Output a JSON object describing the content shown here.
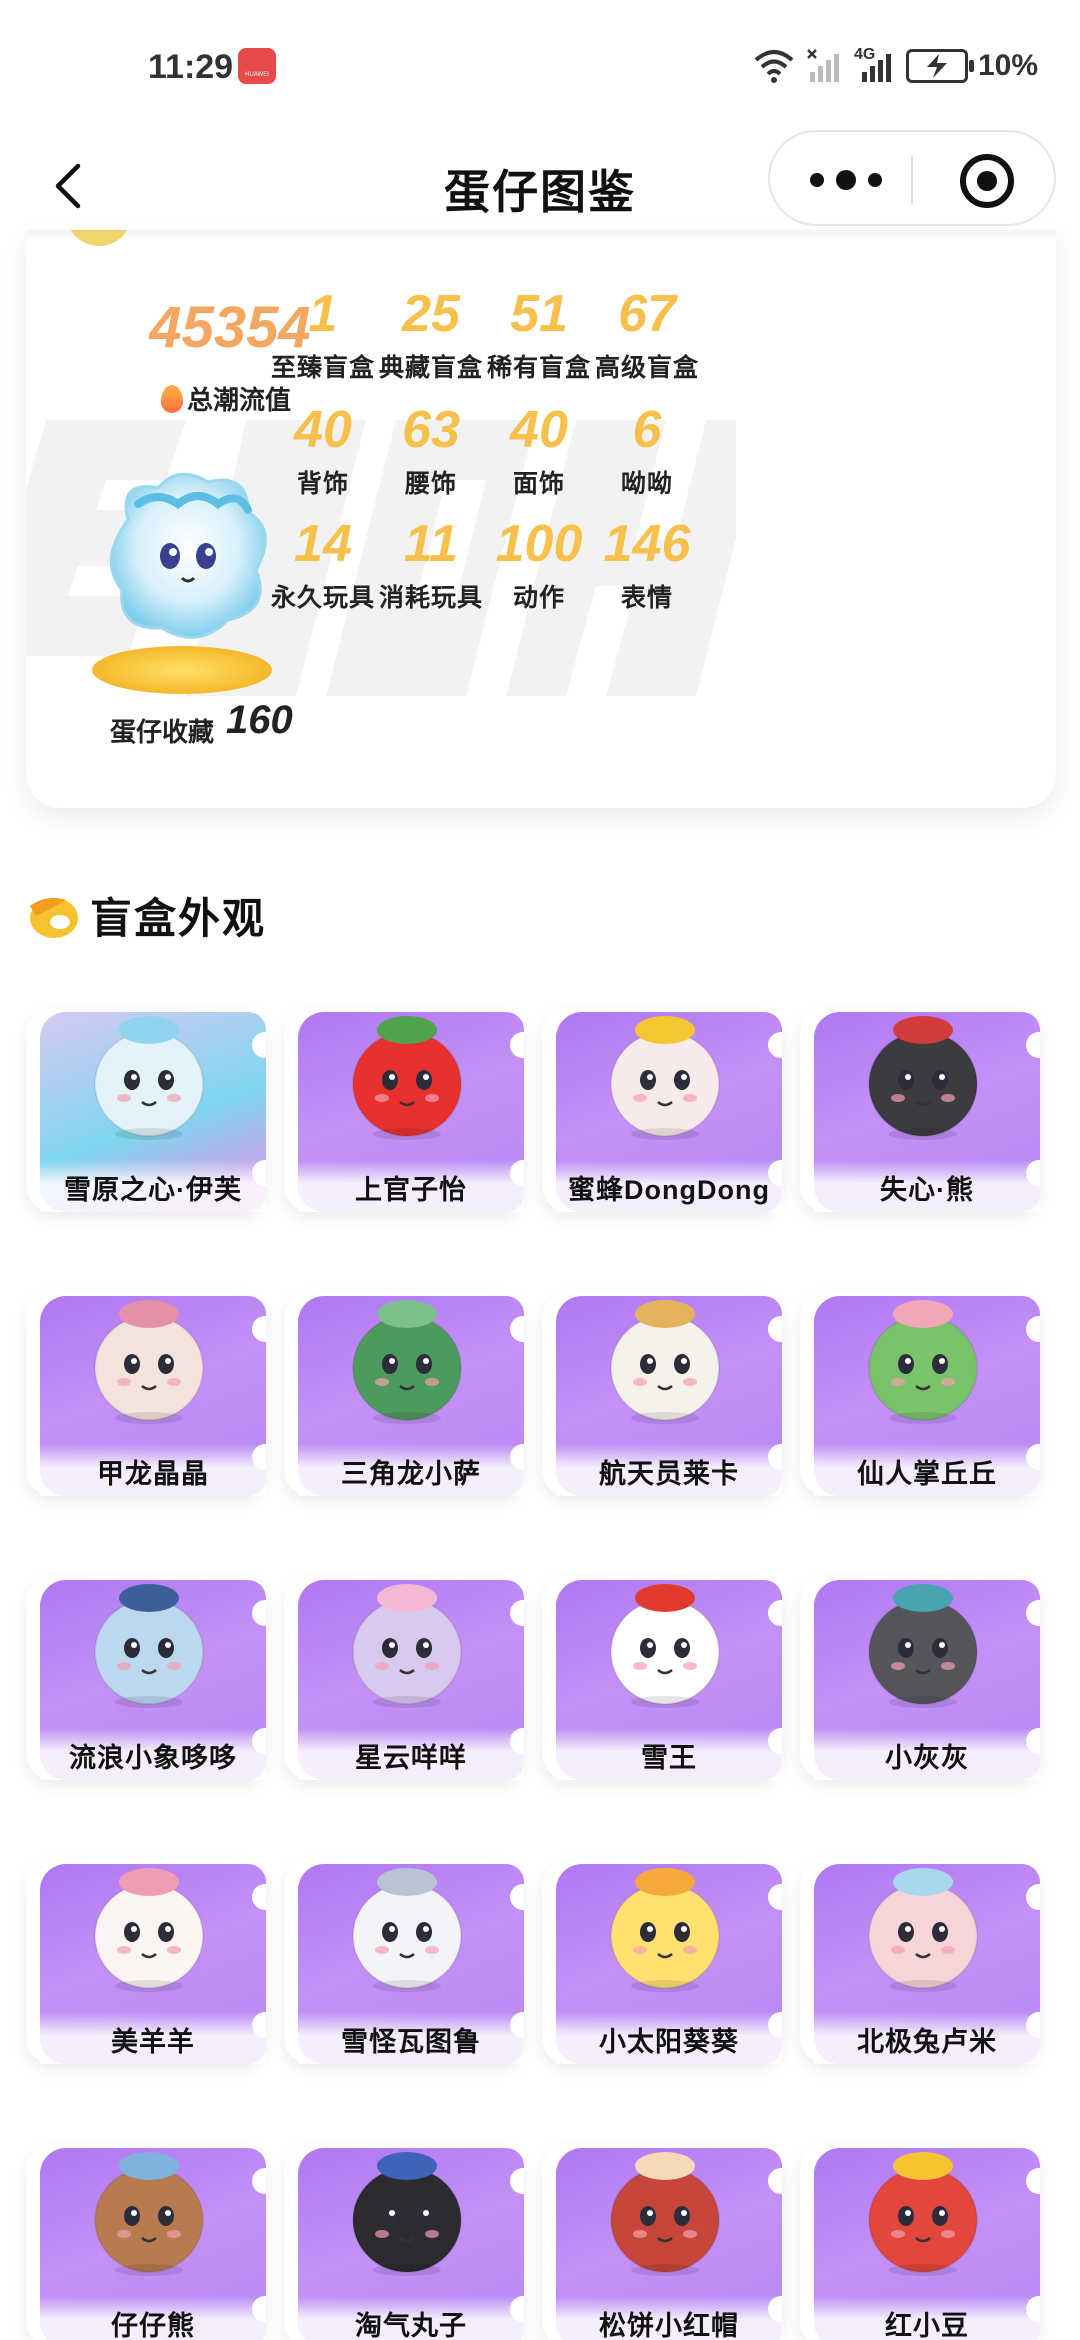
{
  "status_bar": {
    "time": "11:29",
    "badge": "HUAWEI",
    "network": "4G",
    "battery": "10%"
  },
  "nav": {
    "title": "蛋仔图鉴",
    "back_icon": "chevron-left-icon",
    "more_icon": "more-dots-icon",
    "close_icon": "target-circle-icon"
  },
  "stats": {
    "total_value": "45354",
    "total_label": "总潮流值",
    "collection_label": "蛋仔收藏",
    "collection_count": "160",
    "items": [
      {
        "num": "1",
        "label": "至臻盲盒"
      },
      {
        "num": "25",
        "label": "典藏盲盒"
      },
      {
        "num": "51",
        "label": "稀有盲盒"
      },
      {
        "num": "67",
        "label": "高级盲盒"
      },
      {
        "num": "40",
        "label": "背饰"
      },
      {
        "num": "63",
        "label": "腰饰"
      },
      {
        "num": "40",
        "label": "面饰"
      },
      {
        "num": "6",
        "label": "呦呦"
      },
      {
        "num": "14",
        "label": "永久玩具"
      },
      {
        "num": "11",
        "label": "消耗玩具"
      },
      {
        "num": "100",
        "label": "动作"
      },
      {
        "num": "146",
        "label": "表情"
      }
    ]
  },
  "section": {
    "title": "盲盒外观"
  },
  "grid": [
    {
      "name": "雪原之心·伊芙",
      "color": "#e4f2fb",
      "accent": "#8fd3ee"
    },
    {
      "name": "上官子怡",
      "color": "#e8312e",
      "accent": "#4fa34d"
    },
    {
      "name": "蜜蜂DongDong",
      "color": "#f8e9ea",
      "accent": "#f4c62f"
    },
    {
      "name": "失心·熊",
      "color": "#3e3b40",
      "accent": "#d23b3b"
    },
    {
      "name": "甲龙晶晶",
      "color": "#f4e3dc",
      "accent": "#e58fa8"
    },
    {
      "name": "三角龙小萨",
      "color": "#4d9a5e",
      "accent": "#7cc08b"
    },
    {
      "name": "航天员莱卡",
      "color": "#f6f1ea",
      "accent": "#e2b35a"
    },
    {
      "name": "仙人掌丘丘",
      "color": "#79c46b",
      "accent": "#f1a7b5"
    },
    {
      "name": "流浪小象哆哆",
      "color": "#bcd8ee",
      "accent": "#3c5f9a"
    },
    {
      "name": "星云咩咩",
      "color": "#d8c9ef",
      "accent": "#f4b8d4"
    },
    {
      "name": "雪王",
      "color": "#ffffff",
      "accent": "#e03a2f"
    },
    {
      "name": "小灰灰",
      "color": "#55565c",
      "accent": "#4aa3b0"
    },
    {
      "name": "美羊羊",
      "color": "#faf5f2",
      "accent": "#f29bb5"
    },
    {
      "name": "雪怪瓦图鲁",
      "color": "#f3f4f7",
      "accent": "#b9c3d4"
    },
    {
      "name": "小太阳葵葵",
      "color": "#ffe071",
      "accent": "#f6a93a"
    },
    {
      "name": "北极兔卢米",
      "color": "#f7d4d8",
      "accent": "#a9d7ee"
    },
    {
      "name": "仔仔熊",
      "color": "#b87a4f",
      "accent": "#7fb2dd"
    },
    {
      "name": "淘气丸子",
      "color": "#2b2b30",
      "accent": "#3f63b8"
    },
    {
      "name": "松饼小红帽",
      "color": "#c7463c",
      "accent": "#f3d9b8"
    },
    {
      "name": "红小豆",
      "color": "#e2463c",
      "accent": "#f6c431"
    }
  ]
}
